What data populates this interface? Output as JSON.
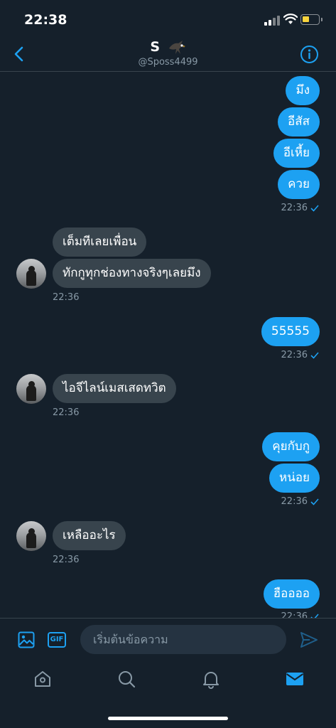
{
  "status_bar": {
    "time": "22:38",
    "battery_color": "#f9d43d"
  },
  "header": {
    "name": "S",
    "name_emoji_icon": "eagle-icon",
    "handle": "@Sposs4499",
    "back_icon": "back-icon",
    "info_icon": "info-icon"
  },
  "colors": {
    "accent": "#1da1f2",
    "background": "#15202b",
    "incoming_bubble": "#38444d",
    "muted": "#8899a6"
  },
  "messages": [
    {
      "direction": "out",
      "text": "มึง"
    },
    {
      "direction": "out",
      "text": "อีสัส"
    },
    {
      "direction": "out",
      "text": "อีเหี้ย"
    },
    {
      "direction": "out",
      "text": "ควย"
    },
    {
      "direction": "out",
      "timestamp": "22:36",
      "read": true
    },
    {
      "direction": "in",
      "text": "เต็มทีเลยเพื่อน"
    },
    {
      "direction": "in",
      "text": "ทักกูทุกช่องทางจริงๆเลยมึง"
    },
    {
      "direction": "in",
      "timestamp": "22:36"
    },
    {
      "direction": "out",
      "text": "55555"
    },
    {
      "direction": "out",
      "timestamp": "22:36",
      "read": true
    },
    {
      "direction": "in",
      "text": "ไอจีไลน์เมสเสดทวิต"
    },
    {
      "direction": "in",
      "timestamp": "22:36"
    },
    {
      "direction": "out",
      "text": "คุยกับกู"
    },
    {
      "direction": "out",
      "text": "หน่อย"
    },
    {
      "direction": "out",
      "timestamp": "22:36",
      "read": true
    },
    {
      "direction": "in",
      "text": "เหลืออะไร"
    },
    {
      "direction": "in",
      "timestamp": "22:36"
    },
    {
      "direction": "out",
      "text": "ฮืออออ"
    },
    {
      "direction": "out",
      "timestamp": "22:36",
      "read": true
    }
  ],
  "composer": {
    "placeholder": "เริ่มต้นข้อความ",
    "gif_label": "GIF"
  },
  "tabbar": {
    "items": [
      "home-icon",
      "search-icon",
      "bell-icon",
      "mail-icon"
    ],
    "active": "mail-icon"
  }
}
